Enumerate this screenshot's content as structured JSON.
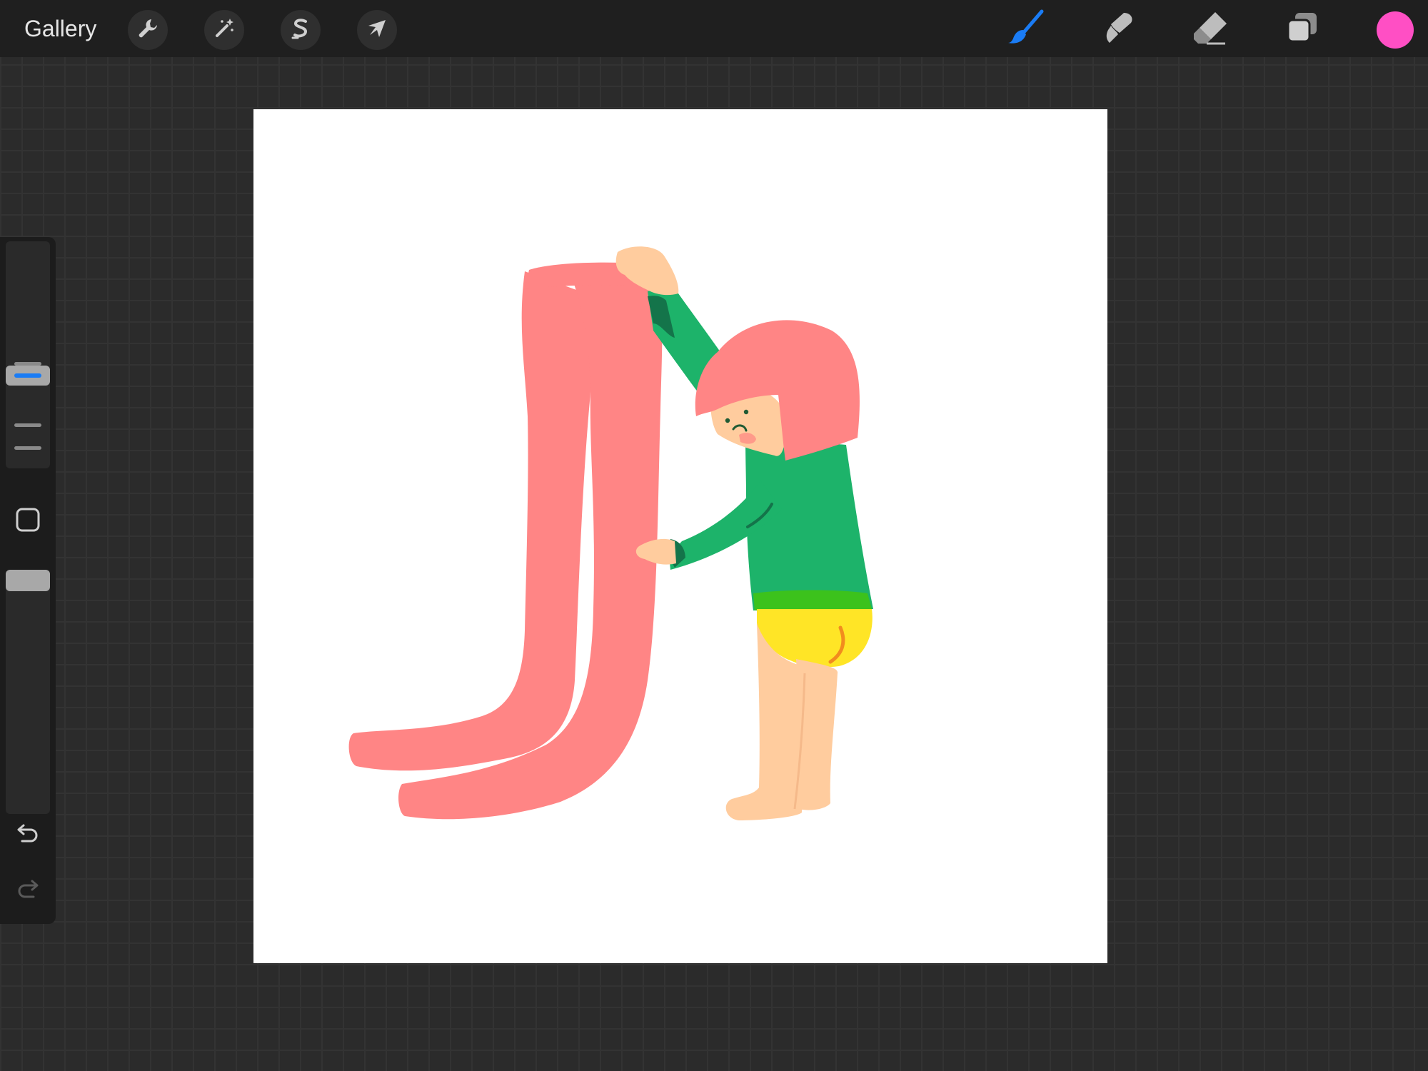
{
  "app": {
    "gallery_label": "Gallery"
  },
  "toolbar": {
    "left_tools": [
      {
        "name": "actions",
        "icon": "wrench-icon"
      },
      {
        "name": "adjustments",
        "icon": "magic-wand-icon"
      },
      {
        "name": "selection",
        "icon": "selection-s-icon"
      },
      {
        "name": "transform",
        "icon": "arrow-cursor-icon"
      }
    ],
    "right_tools": [
      {
        "name": "brush",
        "icon": "brush-icon",
        "active": true
      },
      {
        "name": "smudge",
        "icon": "smudge-icon",
        "active": false
      },
      {
        "name": "eraser",
        "icon": "eraser-icon",
        "active": false
      },
      {
        "name": "layers",
        "icon": "layers-icon",
        "active": false
      }
    ],
    "current_color": "#ff4fc4",
    "active_color": "#1a7cf5"
  },
  "sidebar": {
    "brush_size_level": 0.4,
    "opacity_level": 1.0,
    "undo_icon": "undo-icon",
    "redo_icon": "redo-icon",
    "modify_icon": "square-modify-icon"
  },
  "canvas": {
    "background": "#ffffff",
    "colors": {
      "pants": "#ff8585",
      "sweater": "#1db36a",
      "sweater_shadow": "#14744a",
      "skin": "#ffcc9e",
      "hair": "#ff8585",
      "underwear": "#ffe526",
      "underwear_line": "#f28c1e",
      "waistband": "#3cc21c",
      "blush": "#ff9a8a",
      "eyes": "#1f5a33"
    }
  }
}
